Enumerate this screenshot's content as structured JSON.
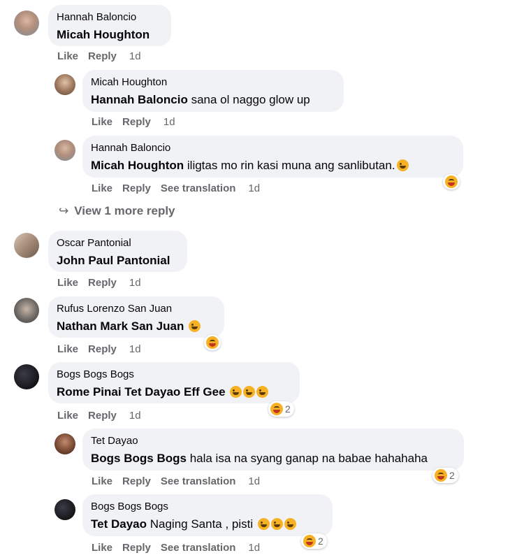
{
  "comments": [
    {
      "author": "Hannah Baloncio",
      "mention": "Micah Houghton",
      "text": "",
      "time": "1d",
      "avatar_color": "#b28f7c"
    },
    {
      "author": "Micah Houghton",
      "mention": "Hannah Baloncio",
      "text": "sana ol naggo glow up",
      "time": "1d",
      "avatar_color": "#8a6a55"
    },
    {
      "author": "Hannah Baloncio",
      "mention": "Micah Houghton",
      "text": "iligtas mo rin kasi muna ang sanlibutan.",
      "time": "1d",
      "avatar_color": "#b28f7c"
    },
    {
      "author": "Oscar Pantonial",
      "mention": "John Paul Pantonial",
      "text": "",
      "time": "1d",
      "avatar_color": "#a58b78"
    },
    {
      "author": "Rufus Lorenzo San Juan",
      "mention": "Nathan Mark San Juan",
      "text": "",
      "time": "1d",
      "avatar_color": "#6f6a66"
    },
    {
      "author": "Bogs Bogs Bogs",
      "mention": "Rome Pinai Tet Dayao Eff Gee",
      "text": "",
      "time": "1d",
      "avatar_color": "#1a1a1f",
      "reaction_count": "2"
    },
    {
      "author": "Tet Dayao",
      "mention": "Bogs Bogs Bogs",
      "text": "hala isa na syang ganap na babae hahahaha",
      "time": "1d",
      "avatar_color": "#7a4a35",
      "reaction_count": "2"
    },
    {
      "author": "Bogs Bogs Bogs",
      "mention": "Tet Dayao",
      "text": "Naging Santa , pisti",
      "time": "1d",
      "avatar_color": "#1a1a1f",
      "reaction_count": "2"
    }
  ],
  "labels": {
    "like": "Like",
    "reply": "Reply",
    "see_translation": "See translation"
  },
  "view_more": {
    "arrow": "↪",
    "label": "View 1 more reply"
  }
}
